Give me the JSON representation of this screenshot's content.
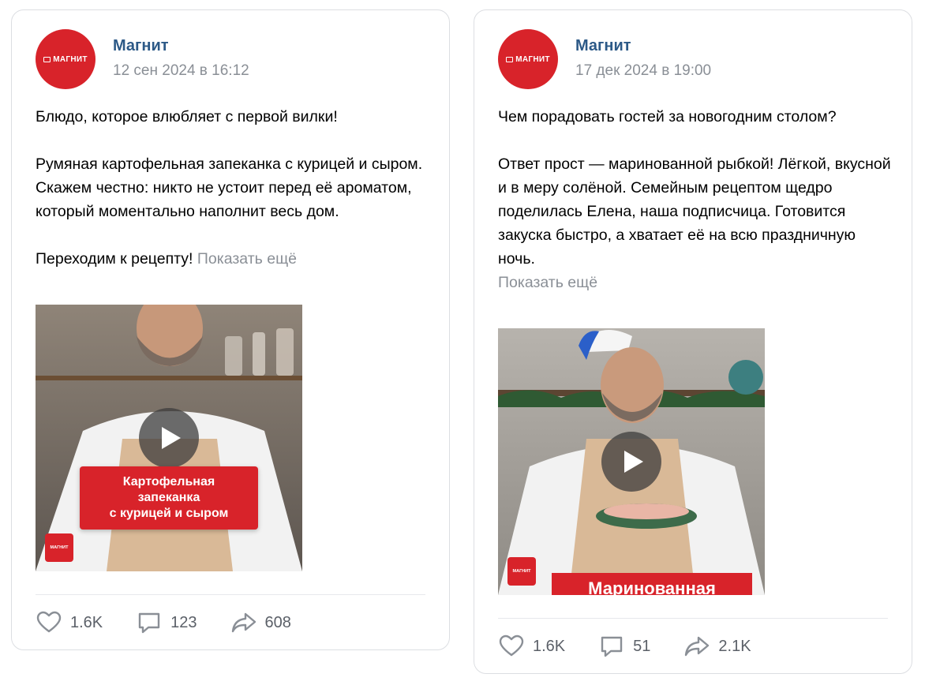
{
  "posts": [
    {
      "author": "Магнит",
      "avatar_logo": "МАГНИТ",
      "date": "12 сен 2024 в 16:12",
      "text": "Блюдо, которое влюбляет с первой вилки!\n\nРумяная картофельная запеканка с курицей и сыром. Скажем честно: никто не устоит перед её ароматом, который моментально наполнит весь дом.\n\nПереходим к рецепту! ",
      "show_more": "Показать ещё",
      "video_banner": "Картофельная\nзапеканка\nс курицей и сыром",
      "video_logo": "МАГНИТ",
      "likes": "1.6K",
      "comments": "123",
      "shares": "608"
    },
    {
      "author": "Магнит",
      "avatar_logo": "МАГНИТ",
      "date": "17 дек 2024 в 19:00",
      "text": "Чем порадовать гостей за новогодним столом?\n\nОтвет прост — маринованной рыбкой! Лёгкой, вкусной и в меру солёной. Семейным рецептом щедро поделилась Елена, наша подписчица. Готовится закуска быстро, а хватает её на всю праздничную ночь.\n",
      "show_more": "Показать ещё",
      "video_banner": "Маринованная",
      "video_logo": "МАГНИТ",
      "likes": "1.6K",
      "comments": "51",
      "shares": "2.1K"
    }
  ],
  "icons": {
    "like": "heart-icon",
    "comment": "comment-icon",
    "share": "share-icon",
    "play": "play-icon"
  },
  "colors": {
    "brand_red": "#d8232a",
    "author_link": "#2c5987",
    "secondary_text": "#8a8f96"
  }
}
